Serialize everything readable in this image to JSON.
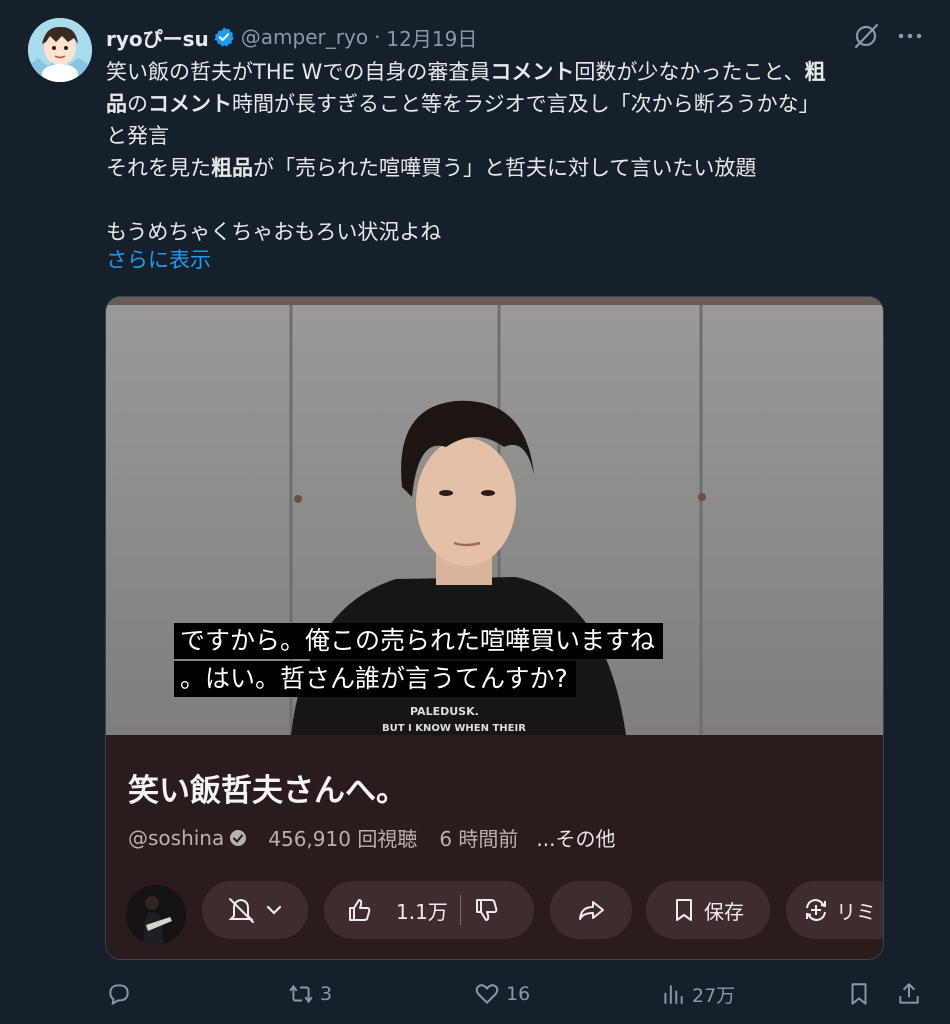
{
  "tweet": {
    "display_name": "ryoぴーsu",
    "handle": "@amper_ryo",
    "separator": "·",
    "date": "12月19日",
    "line1_a": "笑い飯の哲夫がTHE Wでの自身の審査員",
    "line1_b": "コメント",
    "line1_c": "回数が少なかったこと、",
    "line1_d": "粗",
    "line2_a": "品",
    "line2_b": "の",
    "line2_c": "コメント",
    "line2_d": "時間が長すぎること等をラジオで言及し「次から断ろうかな」",
    "line3": "と発言",
    "line4_a": "それを見た",
    "line4_b": "粗品",
    "line4_c": "が「売られた喧嘩買う」と哲夫に対して言いたい放題",
    "line5": "もうめちゃくちゃおもろい状況よね",
    "show_more": "さらに表示"
  },
  "video": {
    "subtitle_line1": "ですから。俺この売られた喧嘩買いますね",
    "subtitle_line2": "。はい。哲さん誰が言うてんすか?",
    "shirt_text1": "PALEDUSK.",
    "shirt_text2": "BUT I KNOW WHEN THEIR",
    "title": "笑い飯哲夫さんへ。",
    "channel": "@soshina",
    "views": "456,910 回視聴",
    "ago": "6 時間前",
    "more": "...その他",
    "like_count": "1.1万",
    "save_label": "保存",
    "remix_label": "リミ"
  },
  "actions": {
    "retweets": "3",
    "likes": "16",
    "views": "27万"
  },
  "colors": {
    "background": "#15202b",
    "accent": "#1d9bf0",
    "muted": "#8b98a5"
  }
}
